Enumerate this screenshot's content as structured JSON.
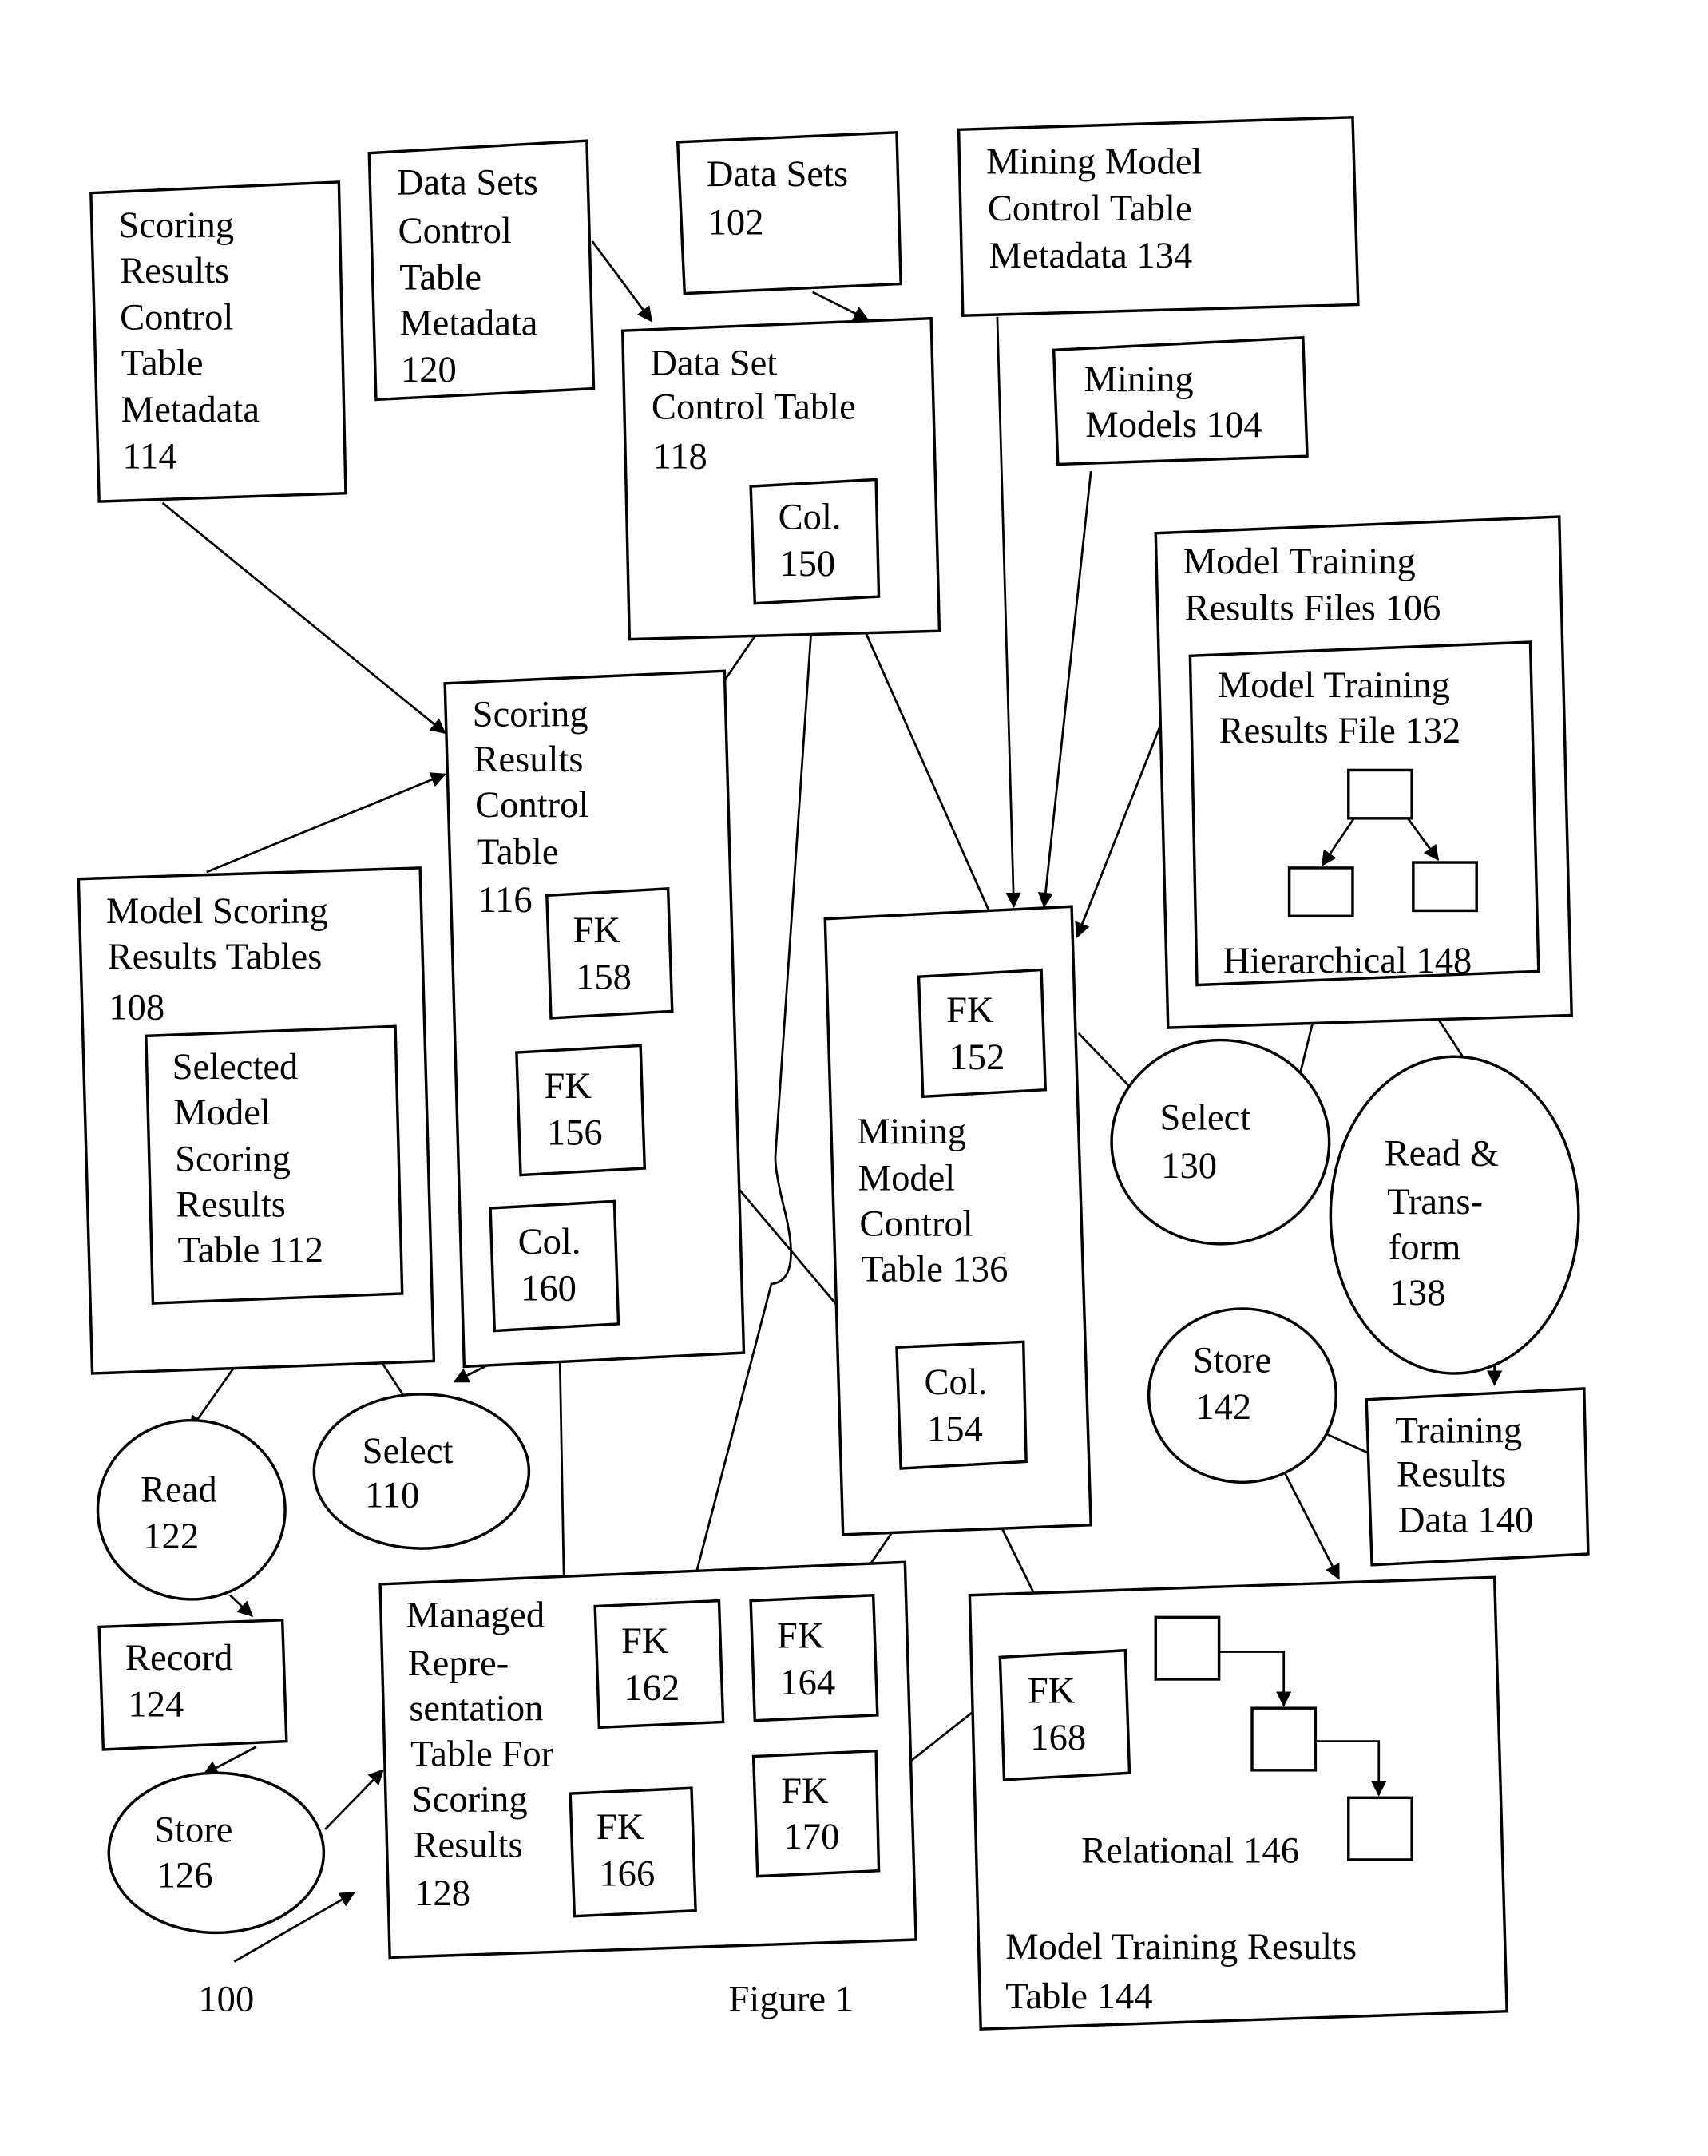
{
  "figure": {
    "caption": "Figure 1",
    "reference_number": "100"
  },
  "nodes": {
    "scoring_results_ctm_114": [
      "Scoring",
      "Results",
      "Control",
      "Table",
      "Metadata",
      "114"
    ],
    "data_sets_ctm_120": [
      "Data Sets",
      "Control",
      "Table",
      "Metadata",
      "120"
    ],
    "data_sets_102": [
      "Data Sets",
      "102"
    ],
    "mining_model_ctm_134": [
      "Mining Model",
      "Control Table",
      "Metadata 134"
    ],
    "data_set_control_table_118": [
      "Data Set",
      "Control Table",
      "118"
    ],
    "col_150": [
      "Col.",
      "150"
    ],
    "mining_models_104": [
      "Mining",
      "Models 104"
    ],
    "model_training_results_files_106": [
      "Model Training",
      "Results Files 106"
    ],
    "model_training_results_file_132": [
      "Model Training",
      "Results File 132"
    ],
    "hierarchical_148": [
      "Hierarchical 148"
    ],
    "scoring_results_control_table_116": [
      "Scoring",
      "Results",
      "Control",
      "Table",
      "116"
    ],
    "fk_158": [
      "FK",
      "158"
    ],
    "fk_156": [
      "FK",
      "156"
    ],
    "col_160": [
      "Col.",
      "160"
    ],
    "model_scoring_results_tables_108": [
      "Model Scoring",
      "Results Tables",
      "108"
    ],
    "selected_model_scoring_results_table_112": [
      "Selected",
      "Model",
      "Scoring",
      "Results",
      "Table 112"
    ],
    "mining_model_control_table_136": [
      "Mining",
      "Model",
      "Control",
      "Table  136"
    ],
    "fk_152": [
      "FK",
      "152"
    ],
    "col_154": [
      "Col.",
      "154"
    ],
    "select_130": [
      "Select",
      "130"
    ],
    "read_transform_138": [
      "Read &",
      "Trans-",
      "form",
      "138"
    ],
    "store_142": [
      "Store",
      "142"
    ],
    "training_results_data_140": [
      "Training",
      "Results",
      "Data 140"
    ],
    "read_122": [
      "Read",
      "122"
    ],
    "select_110": [
      "Select",
      "110"
    ],
    "record_124": [
      "Record",
      "124"
    ],
    "store_126": [
      "Store",
      "126"
    ],
    "managed_representation_table_128": [
      "Managed",
      "Repre-",
      "sentation",
      "Table For",
      "Scoring",
      "Results",
      "128"
    ],
    "fk_162": [
      "FK",
      "162"
    ],
    "fk_164": [
      "FK",
      "164"
    ],
    "fk_166": [
      "FK",
      "166"
    ],
    "fk_170": [
      "FK",
      "170"
    ],
    "model_training_results_table_144": [
      "Model Training Results",
      "Table 144"
    ],
    "fk_168": [
      "FK",
      "168"
    ],
    "relational_146": [
      "Relational 146"
    ]
  }
}
